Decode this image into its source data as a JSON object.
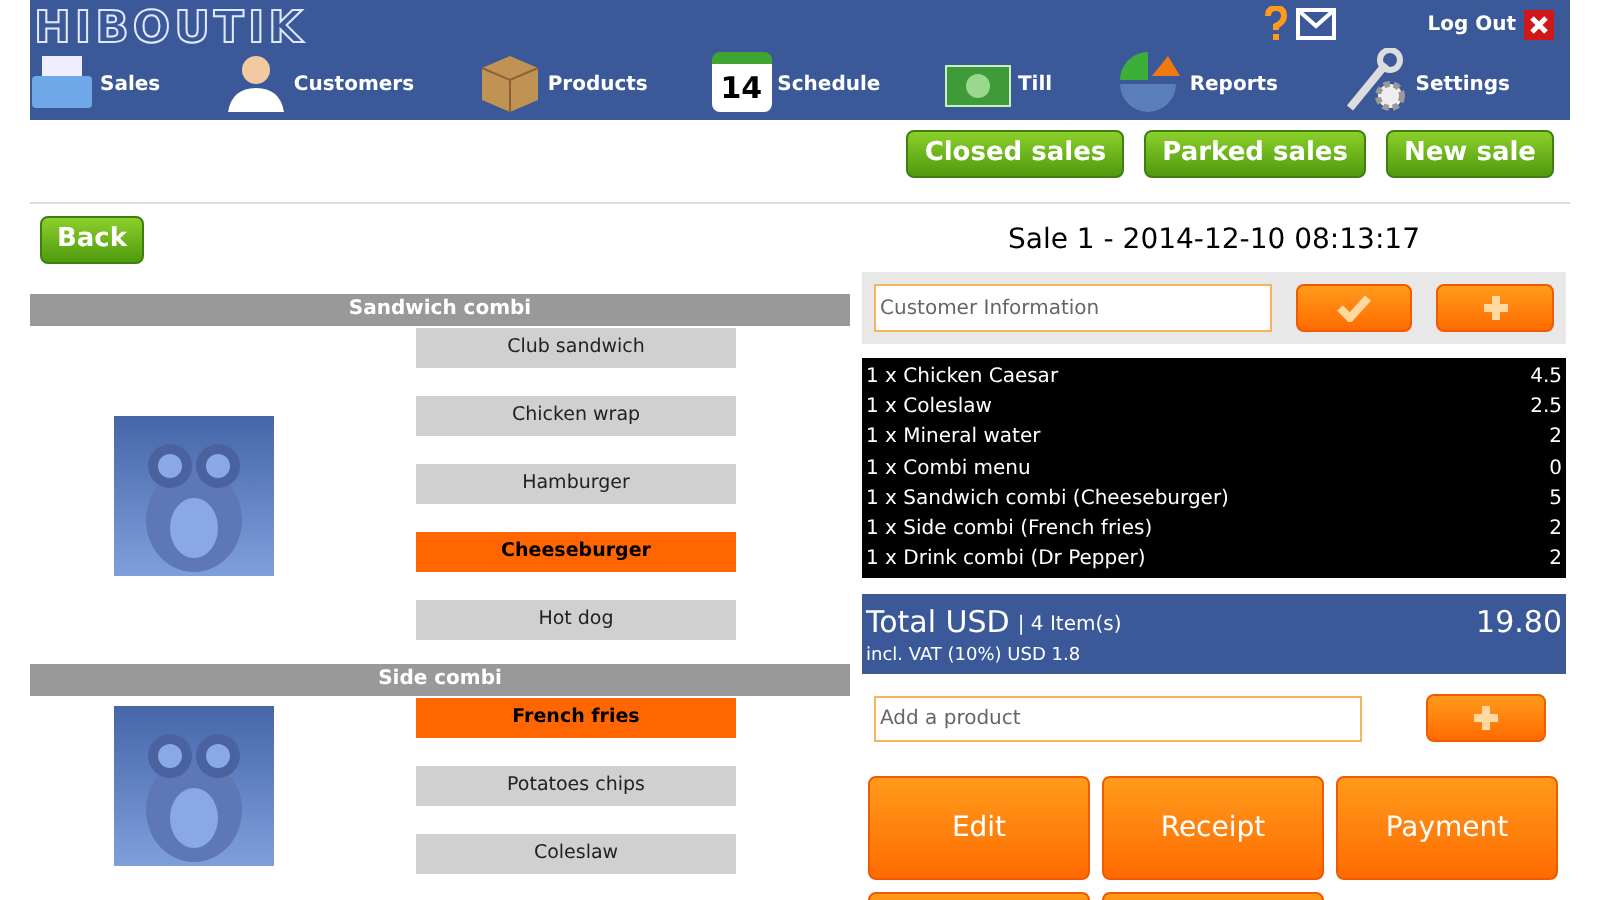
{
  "logo": "HIBOUTIK",
  "top_links": {
    "logout": "Log Out"
  },
  "nav": [
    {
      "label": "Sales",
      "kind": "register"
    },
    {
      "label": "Customers",
      "kind": "person"
    },
    {
      "label": "Products",
      "kind": "box"
    },
    {
      "label": "Schedule",
      "kind": "calendar",
      "icon_text": "14"
    },
    {
      "label": "Till",
      "kind": "cash"
    },
    {
      "label": "Reports",
      "kind": "chart"
    },
    {
      "label": "Settings",
      "kind": "tools"
    }
  ],
  "actions": [
    "Closed sales",
    "Parked sales",
    "New sale"
  ],
  "back": "Back",
  "sale_title": "Sale 1 - 2014-12-10 08:13:17",
  "sections": [
    {
      "title": "Sandwich combi",
      "items": [
        {
          "label": "Club sandwich",
          "selected": false
        },
        {
          "label": "Chicken wrap",
          "selected": false
        },
        {
          "label": "Hamburger",
          "selected": false
        },
        {
          "label": "Cheeseburger",
          "selected": true
        },
        {
          "label": "Hot dog",
          "selected": false
        }
      ]
    },
    {
      "title": "Side combi",
      "items": [
        {
          "label": "French fries",
          "selected": true
        },
        {
          "label": "Potatoes chips",
          "selected": false
        },
        {
          "label": "Coleslaw",
          "selected": false
        }
      ]
    }
  ],
  "customer": {
    "placeholder": "Customer Information"
  },
  "lines": [
    {
      "text": "1 x Chicken Caesar",
      "amount": "4.5"
    },
    {
      "text": "1 x Coleslaw",
      "amount": "2.5"
    },
    {
      "text": "1 x Mineral water",
      "amount": "2"
    },
    {
      "text": "1 x Combi menu",
      "amount": "0"
    },
    {
      "text": "1 x Sandwich combi (Cheeseburger)",
      "amount": "5"
    },
    {
      "text": "1 x Side combi (French fries)",
      "amount": "2"
    },
    {
      "text": "1 x Drink combi (Dr Pepper)",
      "amount": "2"
    }
  ],
  "total": {
    "label": "Total USD",
    "items": "| 4 Item(s)",
    "amount": "19.80",
    "vat": "incl. VAT (10%) USD 1.8"
  },
  "add_product": {
    "placeholder": "Add a product"
  },
  "buttons": [
    "Edit",
    "Receipt",
    "Payment"
  ]
}
